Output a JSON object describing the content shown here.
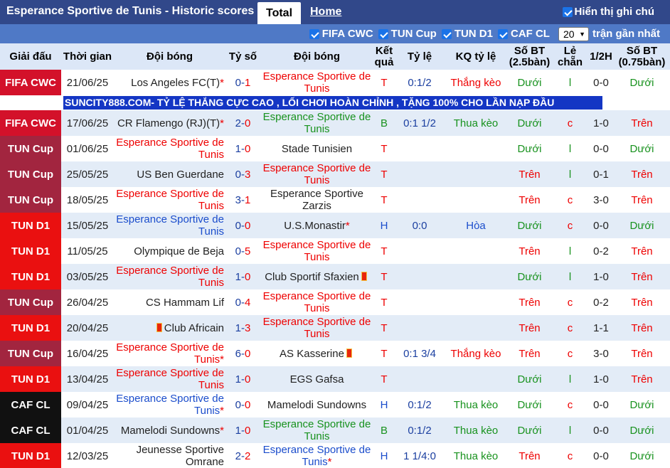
{
  "header": {
    "title": "Esperance Sportive de Tunis - Historic scores",
    "tab_total": "Total",
    "tab_home": "Home",
    "show_note": "Hiển thị ghi chú"
  },
  "filters": {
    "items": [
      "FIFA CWC",
      "TUN Cup",
      "TUN D1",
      "CAF CL"
    ],
    "count": "20",
    "recent_label": "trận gần nhất"
  },
  "columns": {
    "comp": "Giải đấu",
    "time": "Thời gian",
    "home": "Đội bóng",
    "score": "Tỷ số",
    "away": "Đội bóng",
    "result": "Kết quả",
    "odds": "Tỷ lệ",
    "odds_result": "KQ tỷ lệ",
    "ou25": "Số BT (2.5bàn)",
    "oe": "Lẻ chẵn",
    "half": "1/2H",
    "ou075": "Số BT (0.75bàn)"
  },
  "ad_text": "SUNCITY888.COM- TỶ LỆ THẮNG CỰC CAO , LỐI CHƠI HOÀN CHỈNH , TẶNG 100% CHO LẦN NẠP ĐẦU",
  "colors": {
    "fifa": "#d3112a",
    "tuncup": "#a2253f",
    "tund1": "#ea1010",
    "cafcl": "#111111",
    "header_bar": "#31488a",
    "filter_bar": "#4f79c6"
  },
  "matches": [
    {
      "comp": "FIFA CWC",
      "cc": "fifa",
      "date": "21/06/25",
      "home": "Los Angeles FC(T)",
      "home_star": "*",
      "home_color": "",
      "home_flag": false,
      "score_h": "0",
      "score_a": "1",
      "away": "Esperance Sportive de Tunis",
      "away_star": "",
      "away_color": "red",
      "away_flag": false,
      "result": "T",
      "odds": "0:1/2",
      "odds_result": "Thắng kèo",
      "ou": "Dưới",
      "oe": "l",
      "half": "0-0",
      "ou2": "Dưới"
    },
    {
      "comp": "FIFA CWC",
      "cc": "fifa",
      "date": "17/06/25",
      "home": "CR Flamengo (RJ)(T)",
      "home_star": "*",
      "home_color": "",
      "home_flag": false,
      "score_h": "2",
      "score_a": "0",
      "away": "Esperance Sportive de Tunis",
      "away_star": "",
      "away_color": "green",
      "away_flag": false,
      "result": "B",
      "odds": "0:1 1/2",
      "odds_result": "Thua kèo",
      "ou": "Dưới",
      "oe": "c",
      "half": "1-0",
      "ou2": "Trên"
    },
    {
      "comp": "TUN Cup",
      "cc": "tuncup",
      "date": "01/06/25",
      "home": "Esperance Sportive de Tunis",
      "home_star": "",
      "home_color": "red",
      "home_flag": false,
      "score_h": "1",
      "score_a": "0",
      "away": "Stade Tunisien",
      "away_star": "",
      "away_color": "",
      "away_flag": false,
      "result": "T",
      "odds": "",
      "odds_result": "",
      "ou": "Dưới",
      "oe": "l",
      "half": "0-0",
      "ou2": "Dưới"
    },
    {
      "comp": "TUN Cup",
      "cc": "tuncup",
      "date": "25/05/25",
      "home": "US Ben Guerdane",
      "home_star": "",
      "home_color": "",
      "home_flag": false,
      "score_h": "0",
      "score_a": "3",
      "away": "Esperance Sportive de Tunis",
      "away_star": "",
      "away_color": "red",
      "away_flag": false,
      "result": "T",
      "odds": "",
      "odds_result": "",
      "ou": "Trên",
      "oe": "l",
      "half": "0-1",
      "ou2": "Trên"
    },
    {
      "comp": "TUN Cup",
      "cc": "tuncup",
      "date": "18/05/25",
      "home": "Esperance Sportive de Tunis",
      "home_star": "",
      "home_color": "red",
      "home_flag": false,
      "score_h": "3",
      "score_a": "1",
      "away": "Esperance Sportive Zarzis",
      "away_star": "",
      "away_color": "",
      "away_flag": false,
      "result": "T",
      "odds": "",
      "odds_result": "",
      "ou": "Trên",
      "oe": "c",
      "half": "3-0",
      "ou2": "Trên"
    },
    {
      "comp": "TUN D1",
      "cc": "tund1",
      "date": "15/05/25",
      "home": "Esperance Sportive de Tunis",
      "home_star": "",
      "home_color": "blue",
      "home_flag": false,
      "score_h": "0",
      "score_a": "0",
      "away": "U.S.Monastir",
      "away_star": "*",
      "away_color": "",
      "away_flag": false,
      "result": "H",
      "odds": "0:0",
      "odds_result": "Hòa",
      "ou": "Dưới",
      "oe": "c",
      "half": "0-0",
      "ou2": "Dưới"
    },
    {
      "comp": "TUN D1",
      "cc": "tund1",
      "date": "11/05/25",
      "home": "Olympique de Beja",
      "home_star": "",
      "home_color": "",
      "home_flag": false,
      "score_h": "0",
      "score_a": "5",
      "away": "Esperance Sportive de Tunis",
      "away_star": "",
      "away_color": "red",
      "away_flag": false,
      "result": "T",
      "odds": "",
      "odds_result": "",
      "ou": "Trên",
      "oe": "l",
      "half": "0-2",
      "ou2": "Trên"
    },
    {
      "comp": "TUN D1",
      "cc": "tund1",
      "date": "03/05/25",
      "home": "Esperance Sportive de Tunis",
      "home_star": "",
      "home_color": "red",
      "home_flag": false,
      "score_h": "1",
      "score_a": "0",
      "away": "Club Sportif Sfaxien",
      "away_star": "",
      "away_color": "",
      "away_flag": true,
      "result": "T",
      "odds": "",
      "odds_result": "",
      "ou": "Dưới",
      "oe": "l",
      "half": "1-0",
      "ou2": "Trên"
    },
    {
      "comp": "TUN Cup",
      "cc": "tuncup",
      "date": "26/04/25",
      "home": "CS Hammam Lif",
      "home_star": "",
      "home_color": "",
      "home_flag": false,
      "score_h": "0",
      "score_a": "4",
      "away": "Esperance Sportive de Tunis",
      "away_star": "",
      "away_color": "red",
      "away_flag": false,
      "result": "T",
      "odds": "",
      "odds_result": "",
      "ou": "Trên",
      "oe": "c",
      "half": "0-2",
      "ou2": "Trên"
    },
    {
      "comp": "TUN D1",
      "cc": "tund1",
      "date": "20/04/25",
      "home": "Club Africain",
      "home_star": "",
      "home_color": "",
      "home_flag": true,
      "score_h": "1",
      "score_a": "3",
      "away": "Esperance Sportive de Tunis",
      "away_star": "",
      "away_color": "red",
      "away_flag": false,
      "result": "T",
      "odds": "",
      "odds_result": "",
      "ou": "Trên",
      "oe": "c",
      "half": "1-1",
      "ou2": "Trên"
    },
    {
      "comp": "TUN Cup",
      "cc": "tuncup",
      "date": "16/04/25",
      "home": "Esperance Sportive de Tunis",
      "home_star": "*",
      "home_color": "red",
      "home_flag": false,
      "score_h": "6",
      "score_a": "0",
      "away": "AS Kasserine",
      "away_star": "",
      "away_color": "",
      "away_flag": true,
      "result": "T",
      "odds": "0:1 3/4",
      "odds_result": "Thắng kèo",
      "ou": "Trên",
      "oe": "c",
      "half": "3-0",
      "ou2": "Trên"
    },
    {
      "comp": "TUN D1",
      "cc": "tund1",
      "date": "13/04/25",
      "home": "Esperance Sportive de Tunis",
      "home_star": "",
      "home_color": "red",
      "home_flag": false,
      "score_h": "1",
      "score_a": "0",
      "away": "EGS Gafsa",
      "away_star": "",
      "away_color": "",
      "away_flag": false,
      "result": "T",
      "odds": "",
      "odds_result": "",
      "ou": "Dưới",
      "oe": "l",
      "half": "1-0",
      "ou2": "Trên"
    },
    {
      "comp": "CAF CL",
      "cc": "cafcl",
      "date": "09/04/25",
      "home": "Esperance Sportive de Tunis",
      "home_star": "*",
      "home_color": "blue",
      "home_flag": false,
      "score_h": "0",
      "score_a": "0",
      "away": "Mamelodi Sundowns",
      "away_star": "",
      "away_color": "",
      "away_flag": false,
      "result": "H",
      "odds": "0:1/2",
      "odds_result": "Thua kèo",
      "ou": "Dưới",
      "oe": "c",
      "half": "0-0",
      "ou2": "Dưới"
    },
    {
      "comp": "CAF CL",
      "cc": "cafcl",
      "date": "01/04/25",
      "home": "Mamelodi Sundowns",
      "home_star": "*",
      "home_color": "",
      "home_flag": false,
      "score_h": "1",
      "score_a": "0",
      "away": "Esperance Sportive de Tunis",
      "away_star": "",
      "away_color": "green",
      "away_flag": false,
      "result": "B",
      "odds": "0:1/2",
      "odds_result": "Thua kèo",
      "ou": "Dưới",
      "oe": "l",
      "half": "0-0",
      "ou2": "Dưới"
    },
    {
      "comp": "TUN D1",
      "cc": "tund1",
      "date": "12/03/25",
      "home": "Jeunesse Sportive Omrane",
      "home_star": "",
      "home_color": "",
      "home_flag": false,
      "score_h": "2",
      "score_a": "2",
      "away": "Esperance Sportive de Tunis",
      "away_star": "*",
      "away_color": "blue",
      "away_flag": false,
      "result": "H",
      "odds": "1 1/4:0",
      "odds_result": "Thua kèo",
      "ou": "Trên",
      "oe": "c",
      "half": "0-0",
      "ou2": "Dưới"
    }
  ]
}
